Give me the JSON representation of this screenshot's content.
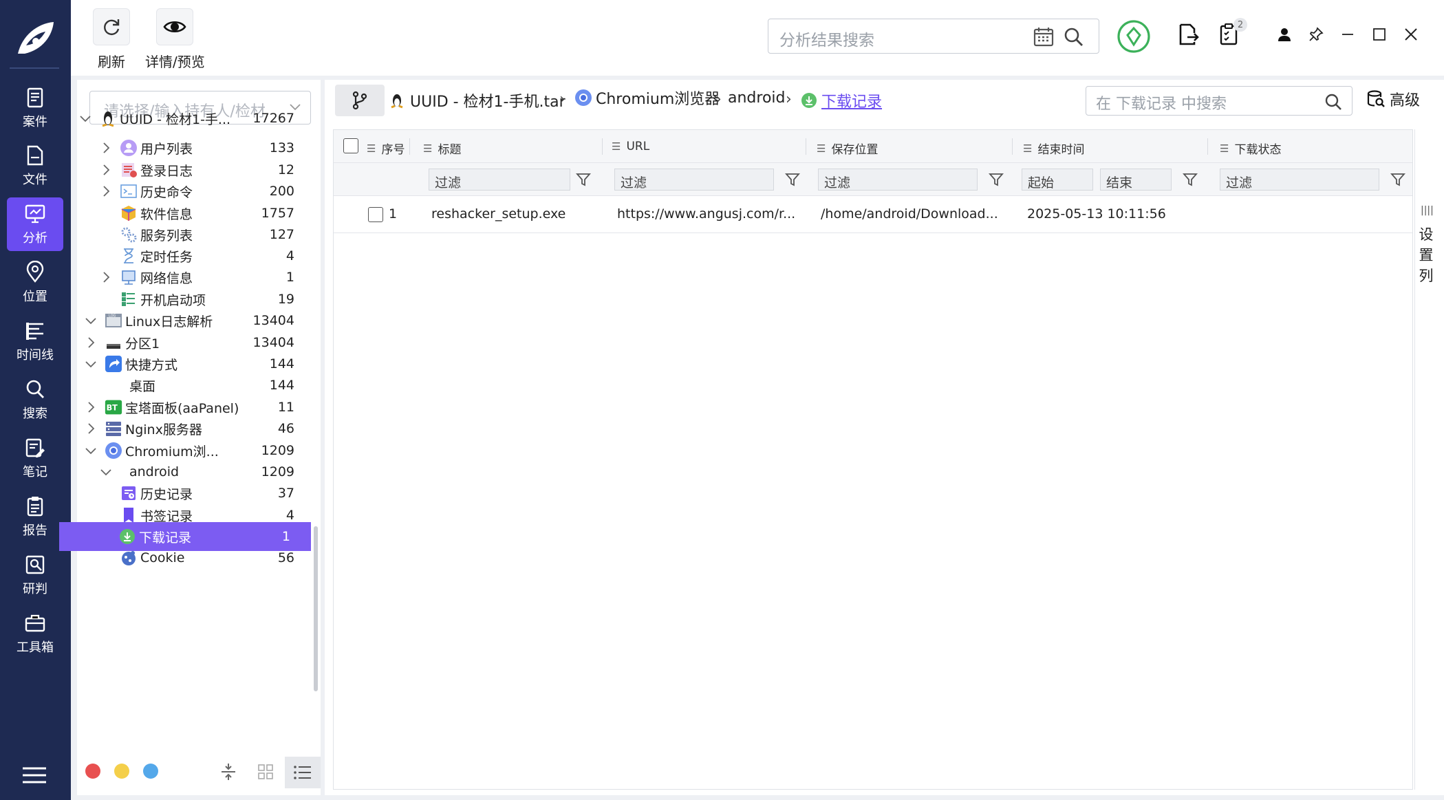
{
  "toolbar": {
    "refresh_label": "刷新",
    "detail_label": "详情/预览"
  },
  "global_search": {
    "placeholder": "分析结果搜索"
  },
  "top_badge_count": "2",
  "nav": [
    {
      "label": "案件",
      "icon": "case-icon"
    },
    {
      "label": "文件",
      "icon": "file-icon"
    },
    {
      "label": "分析",
      "icon": "analysis-icon",
      "active": true
    },
    {
      "label": "位置",
      "icon": "location-icon"
    },
    {
      "label": "时间线",
      "icon": "timeline-icon"
    },
    {
      "label": "搜索",
      "icon": "search-icon"
    },
    {
      "label": "笔记",
      "icon": "note-icon"
    },
    {
      "label": "报告",
      "icon": "report-icon"
    },
    {
      "label": "研判",
      "icon": "judge-icon"
    },
    {
      "label": "工具箱",
      "icon": "toolbox-icon"
    }
  ],
  "tree": {
    "owner_placeholder": "请选择/输入持有人/检材",
    "items": [
      {
        "label": "UUID - 检材1-手...",
        "count": "17267"
      },
      {
        "label": "用户列表",
        "count": "133"
      },
      {
        "label": "登录日志",
        "count": "12"
      },
      {
        "label": "历史命令",
        "count": "200"
      },
      {
        "label": "软件信息",
        "count": "1757"
      },
      {
        "label": "服务列表",
        "count": "127"
      },
      {
        "label": "定时任务",
        "count": "4"
      },
      {
        "label": "网络信息",
        "count": "1"
      },
      {
        "label": "开机启动项",
        "count": "19"
      },
      {
        "label": "Linux日志解析",
        "count": "13404"
      },
      {
        "label": "分区1",
        "count": "13404"
      },
      {
        "label": "快捷方式",
        "count": "144"
      },
      {
        "label": "桌面",
        "count": "144"
      },
      {
        "label": "宝塔面板(aaPanel)",
        "count": "11"
      },
      {
        "label": "Nginx服务器",
        "count": "46"
      },
      {
        "label": "Chromium浏...",
        "count": "1209"
      },
      {
        "label": "android",
        "count": "1209"
      },
      {
        "label": "历史记录",
        "count": "37"
      },
      {
        "label": "书签记录",
        "count": "4"
      },
      {
        "label": "下载记录",
        "count": "1"
      },
      {
        "label": "Cookie",
        "count": "56"
      }
    ]
  },
  "breadcrumb": {
    "root": "UUID - 检材1-手机.tar",
    "browser": "Chromium浏览器",
    "user": "android",
    "current": "下载记录"
  },
  "data_search": {
    "placeholder": "在 下载记录 中搜索"
  },
  "advanced_label": "高级",
  "grid": {
    "columns": [
      "序号",
      "标题",
      "URL",
      "保存位置",
      "结束时间",
      "下载状态"
    ],
    "filter_placeholder": "过滤",
    "date_start": "起始",
    "date_end": "结束",
    "rows": [
      {
        "index": "1",
        "title": "reshacker_setup.exe",
        "url": "https://www.angusj.com/r...",
        "path": "/home/android/Download...",
        "end_time": "2025-05-13 10:11:56",
        "status": ""
      }
    ]
  },
  "column_settings_label": "设置列",
  "colors": {
    "rail": "#1e2a52",
    "accent": "#6a4cf0",
    "selected_row": "#7c5cf2"
  }
}
